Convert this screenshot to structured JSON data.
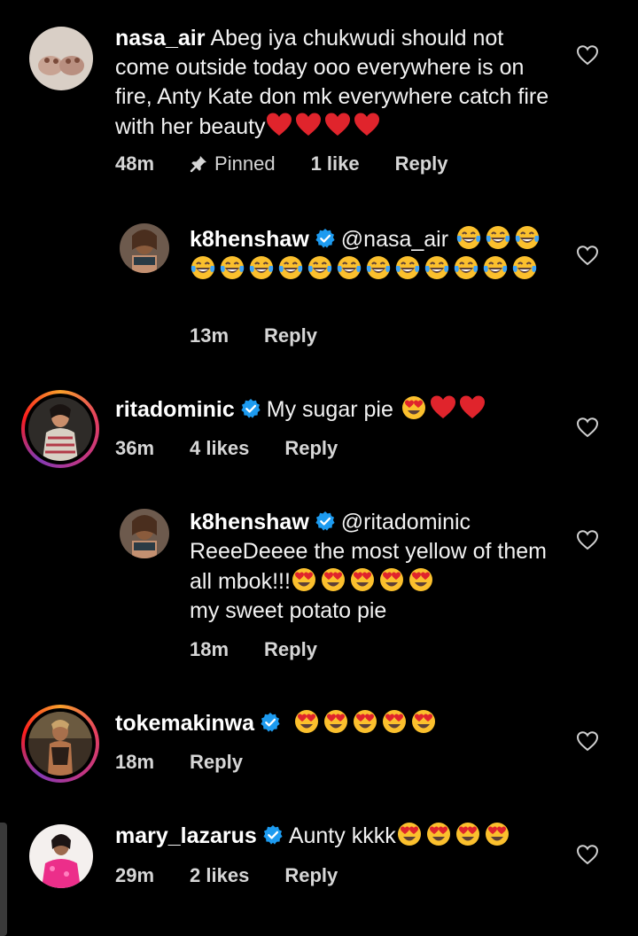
{
  "comments": [
    {
      "username": "nasa_air",
      "text": "Abeg iya chukwudi should not come outside today ooo everywhere is on fire, Anty Kate don mk everywhere catch fire with her beauty",
      "time": "48m",
      "pinned_label": "Pinned",
      "likes": "1 like",
      "reply_label": "Reply"
    },
    {
      "username": "k8henshaw",
      "text": "@nasa_air",
      "time": "13m",
      "reply_label": "Reply"
    },
    {
      "username": "ritadominic",
      "text": "My sugar pie",
      "time": "36m",
      "likes": "4 likes",
      "reply_label": "Reply"
    },
    {
      "username": "k8henshaw",
      "text": "@ritadominic ReeeDeeee the most yellow of them all mbok!!!",
      "text2": "my sweet potato pie",
      "time": "18m",
      "reply_label": "Reply"
    },
    {
      "username": "tokemakinwa",
      "text": "",
      "time": "18m",
      "reply_label": "Reply"
    },
    {
      "username": "mary_lazarus",
      "text": "Aunty kkkk",
      "time": "29m",
      "likes": "2 likes",
      "reply_label": "Reply"
    }
  ],
  "icons": {
    "like": "heart-outline-icon",
    "verified": "verified-badge-icon",
    "pinned": "pin-icon"
  },
  "colors": {
    "background": "#000000",
    "verified": "#1d9bf0",
    "heart_emoji": "#e0242c",
    "emoji_face": "#fbc02d"
  }
}
